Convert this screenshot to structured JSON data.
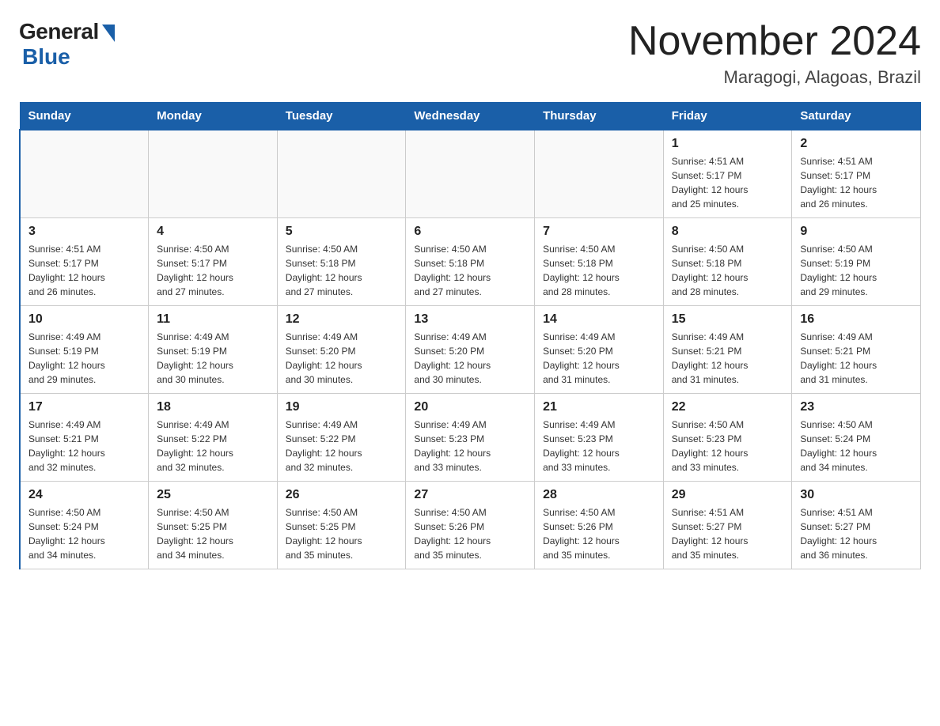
{
  "header": {
    "logo_general": "General",
    "logo_blue": "Blue",
    "month_title": "November 2024",
    "location": "Maragogi, Alagoas, Brazil"
  },
  "days_of_week": [
    "Sunday",
    "Monday",
    "Tuesday",
    "Wednesday",
    "Thursday",
    "Friday",
    "Saturday"
  ],
  "weeks": [
    [
      {
        "day": "",
        "info": ""
      },
      {
        "day": "",
        "info": ""
      },
      {
        "day": "",
        "info": ""
      },
      {
        "day": "",
        "info": ""
      },
      {
        "day": "",
        "info": ""
      },
      {
        "day": "1",
        "info": "Sunrise: 4:51 AM\nSunset: 5:17 PM\nDaylight: 12 hours\nand 25 minutes."
      },
      {
        "day": "2",
        "info": "Sunrise: 4:51 AM\nSunset: 5:17 PM\nDaylight: 12 hours\nand 26 minutes."
      }
    ],
    [
      {
        "day": "3",
        "info": "Sunrise: 4:51 AM\nSunset: 5:17 PM\nDaylight: 12 hours\nand 26 minutes."
      },
      {
        "day": "4",
        "info": "Sunrise: 4:50 AM\nSunset: 5:17 PM\nDaylight: 12 hours\nand 27 minutes."
      },
      {
        "day": "5",
        "info": "Sunrise: 4:50 AM\nSunset: 5:18 PM\nDaylight: 12 hours\nand 27 minutes."
      },
      {
        "day": "6",
        "info": "Sunrise: 4:50 AM\nSunset: 5:18 PM\nDaylight: 12 hours\nand 27 minutes."
      },
      {
        "day": "7",
        "info": "Sunrise: 4:50 AM\nSunset: 5:18 PM\nDaylight: 12 hours\nand 28 minutes."
      },
      {
        "day": "8",
        "info": "Sunrise: 4:50 AM\nSunset: 5:18 PM\nDaylight: 12 hours\nand 28 minutes."
      },
      {
        "day": "9",
        "info": "Sunrise: 4:50 AM\nSunset: 5:19 PM\nDaylight: 12 hours\nand 29 minutes."
      }
    ],
    [
      {
        "day": "10",
        "info": "Sunrise: 4:49 AM\nSunset: 5:19 PM\nDaylight: 12 hours\nand 29 minutes."
      },
      {
        "day": "11",
        "info": "Sunrise: 4:49 AM\nSunset: 5:19 PM\nDaylight: 12 hours\nand 30 minutes."
      },
      {
        "day": "12",
        "info": "Sunrise: 4:49 AM\nSunset: 5:20 PM\nDaylight: 12 hours\nand 30 minutes."
      },
      {
        "day": "13",
        "info": "Sunrise: 4:49 AM\nSunset: 5:20 PM\nDaylight: 12 hours\nand 30 minutes."
      },
      {
        "day": "14",
        "info": "Sunrise: 4:49 AM\nSunset: 5:20 PM\nDaylight: 12 hours\nand 31 minutes."
      },
      {
        "day": "15",
        "info": "Sunrise: 4:49 AM\nSunset: 5:21 PM\nDaylight: 12 hours\nand 31 minutes."
      },
      {
        "day": "16",
        "info": "Sunrise: 4:49 AM\nSunset: 5:21 PM\nDaylight: 12 hours\nand 31 minutes."
      }
    ],
    [
      {
        "day": "17",
        "info": "Sunrise: 4:49 AM\nSunset: 5:21 PM\nDaylight: 12 hours\nand 32 minutes."
      },
      {
        "day": "18",
        "info": "Sunrise: 4:49 AM\nSunset: 5:22 PM\nDaylight: 12 hours\nand 32 minutes."
      },
      {
        "day": "19",
        "info": "Sunrise: 4:49 AM\nSunset: 5:22 PM\nDaylight: 12 hours\nand 32 minutes."
      },
      {
        "day": "20",
        "info": "Sunrise: 4:49 AM\nSunset: 5:23 PM\nDaylight: 12 hours\nand 33 minutes."
      },
      {
        "day": "21",
        "info": "Sunrise: 4:49 AM\nSunset: 5:23 PM\nDaylight: 12 hours\nand 33 minutes."
      },
      {
        "day": "22",
        "info": "Sunrise: 4:50 AM\nSunset: 5:23 PM\nDaylight: 12 hours\nand 33 minutes."
      },
      {
        "day": "23",
        "info": "Sunrise: 4:50 AM\nSunset: 5:24 PM\nDaylight: 12 hours\nand 34 minutes."
      }
    ],
    [
      {
        "day": "24",
        "info": "Sunrise: 4:50 AM\nSunset: 5:24 PM\nDaylight: 12 hours\nand 34 minutes."
      },
      {
        "day": "25",
        "info": "Sunrise: 4:50 AM\nSunset: 5:25 PM\nDaylight: 12 hours\nand 34 minutes."
      },
      {
        "day": "26",
        "info": "Sunrise: 4:50 AM\nSunset: 5:25 PM\nDaylight: 12 hours\nand 35 minutes."
      },
      {
        "day": "27",
        "info": "Sunrise: 4:50 AM\nSunset: 5:26 PM\nDaylight: 12 hours\nand 35 minutes."
      },
      {
        "day": "28",
        "info": "Sunrise: 4:50 AM\nSunset: 5:26 PM\nDaylight: 12 hours\nand 35 minutes."
      },
      {
        "day": "29",
        "info": "Sunrise: 4:51 AM\nSunset: 5:27 PM\nDaylight: 12 hours\nand 35 minutes."
      },
      {
        "day": "30",
        "info": "Sunrise: 4:51 AM\nSunset: 5:27 PM\nDaylight: 12 hours\nand 36 minutes."
      }
    ]
  ]
}
